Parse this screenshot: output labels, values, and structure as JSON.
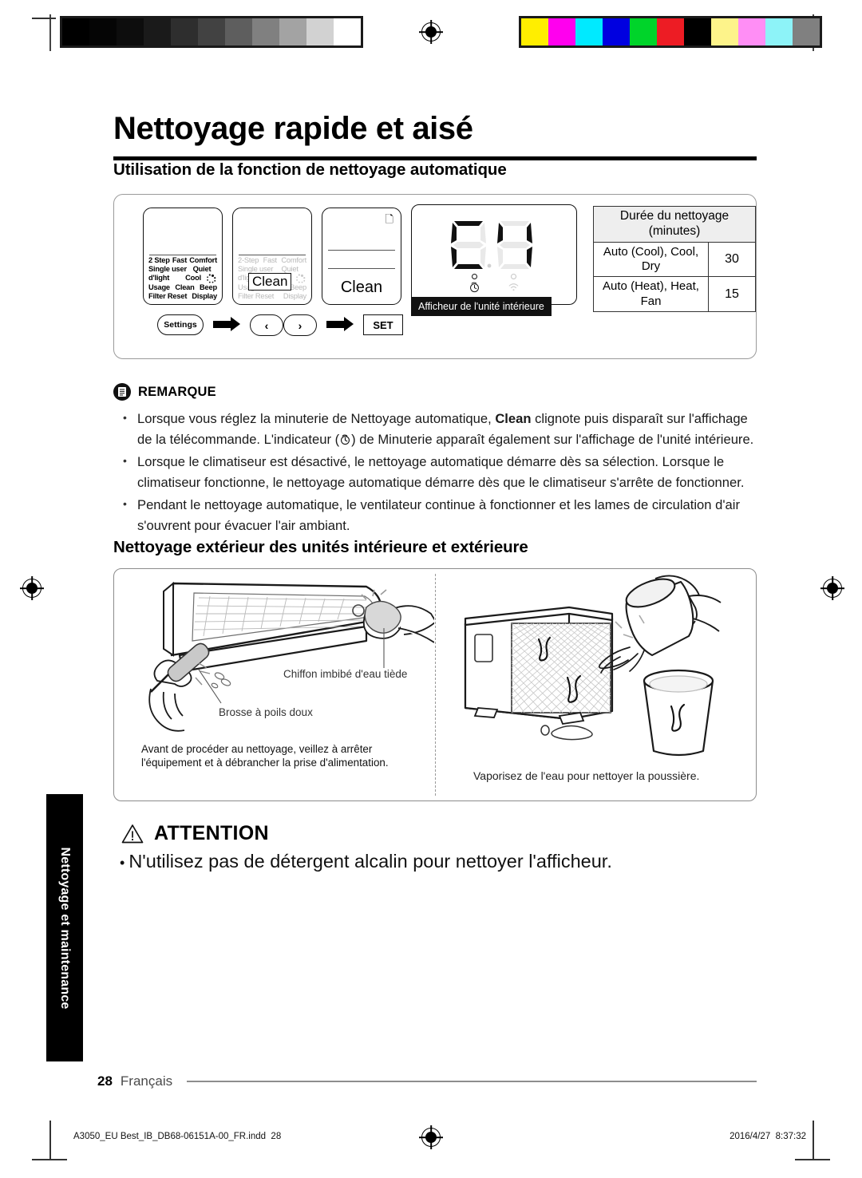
{
  "document": {
    "title": "Nettoyage rapide et aisé",
    "page_number": "28",
    "language": "Français",
    "print_filename": "A3050_EU Best_IB_DB68-06151A-00_FR.indd",
    "print_page": "28",
    "print_date": "2016/4/27",
    "print_time": "8:37:32",
    "side_tab": "Nettoyage et maintenance"
  },
  "calibration": {
    "gray_swatches": [
      "#000000",
      "#050505",
      "#0d0d0d",
      "#1a1a1a",
      "#2e2e2e",
      "#424242",
      "#5e5e5e",
      "#808080",
      "#a3a3a3",
      "#d2d2d2",
      "#ffffff"
    ],
    "color_swatches": [
      "#ffee00",
      "#ff00ee",
      "#00eaff",
      "#0000e0",
      "#00d42a",
      "#ed1c24",
      "#000000",
      "#fdf38a",
      "#ff8ef5",
      "#8df3f8",
      "#808080"
    ]
  },
  "section1": {
    "heading": "Utilisation de la fonction de nettoyage automatique",
    "remote1": {
      "menu": [
        [
          "2 Step",
          "Fast",
          "Comfort"
        ],
        [
          "Single user",
          "Quiet",
          ""
        ],
        [
          "d'light",
          "Cool",
          ""
        ],
        [
          "Usage",
          "Clean",
          "Beep"
        ],
        [
          "Filter Reset",
          "",
          "Display"
        ]
      ]
    },
    "remote2": {
      "menu": [
        [
          "2-Step",
          "Fast",
          "Comfort"
        ],
        [
          "Single user",
          "Quiet",
          ""
        ],
        [
          "d'light",
          "Cool",
          ""
        ],
        [
          "Usage",
          "Clean",
          "Beep"
        ],
        [
          "Filter Reset",
          "",
          "Display"
        ]
      ],
      "highlight": "Clean"
    },
    "remote3": {
      "label": "Clean"
    },
    "buttons": {
      "settings": "Settings",
      "prev": "‹",
      "next": "›",
      "set": "SET"
    },
    "display_unit": {
      "segment_value": "88",
      "caption": "Afficheur de l'unité intérieure"
    },
    "table": {
      "header": "Durée du nettoyage (minutes)",
      "rows": [
        {
          "mode": "Auto (Cool), Cool, Dry",
          "minutes": "30"
        },
        {
          "mode": "Auto (Heat), Heat, Fan",
          "minutes": "15"
        }
      ]
    }
  },
  "note": {
    "title": "REMARQUE",
    "items": [
      "Lorsque vous réglez la minuterie de Nettoyage automatique, Clean clignote puis disparaît sur l'affichage de la télécommande. L'indicateur (⏱) de Minuterie apparaît également sur l'affichage de l'unité intérieure.",
      "Lorsque le climatiseur est désactivé, le nettoyage automatique démarre dès sa sélection. Lorsque le climatiseur fonctionne, le nettoyage automatique démarre dès que le climatiseur s'arrête de fonctionner.",
      "Pendant le nettoyage automatique, le ventilateur continue à fonctionner et les lames de circulation d'air s'ouvrent pour évacuer l'air ambiant."
    ],
    "item1_parts": {
      "before_bold": "Lorsque vous réglez la minuterie de Nettoyage automatique, ",
      "bold": "Clean",
      "after_bold_1": " clignote puis disparaît sur l'affichage de la télécommande. L'indicateur (",
      "after_bold_2": ") de Minuterie apparaît également sur l'affichage de l'unité intérieure."
    }
  },
  "section2": {
    "heading": "Nettoyage extérieur des unités intérieure et extérieure",
    "left_panel": {
      "label_cloth": "Chiffon imbibé d'eau tiède",
      "label_brush": "Brosse à poils doux",
      "warning": "Avant de procéder au nettoyage, veillez à arrêter l'équipement et à débrancher la prise d'alimentation."
    },
    "right_panel": {
      "caption": "Vaporisez de l'eau pour nettoyer la poussière."
    }
  },
  "caution": {
    "title": "ATTENTION",
    "body": "N'utilisez pas de détergent alcalin pour nettoyer l'afficheur."
  }
}
